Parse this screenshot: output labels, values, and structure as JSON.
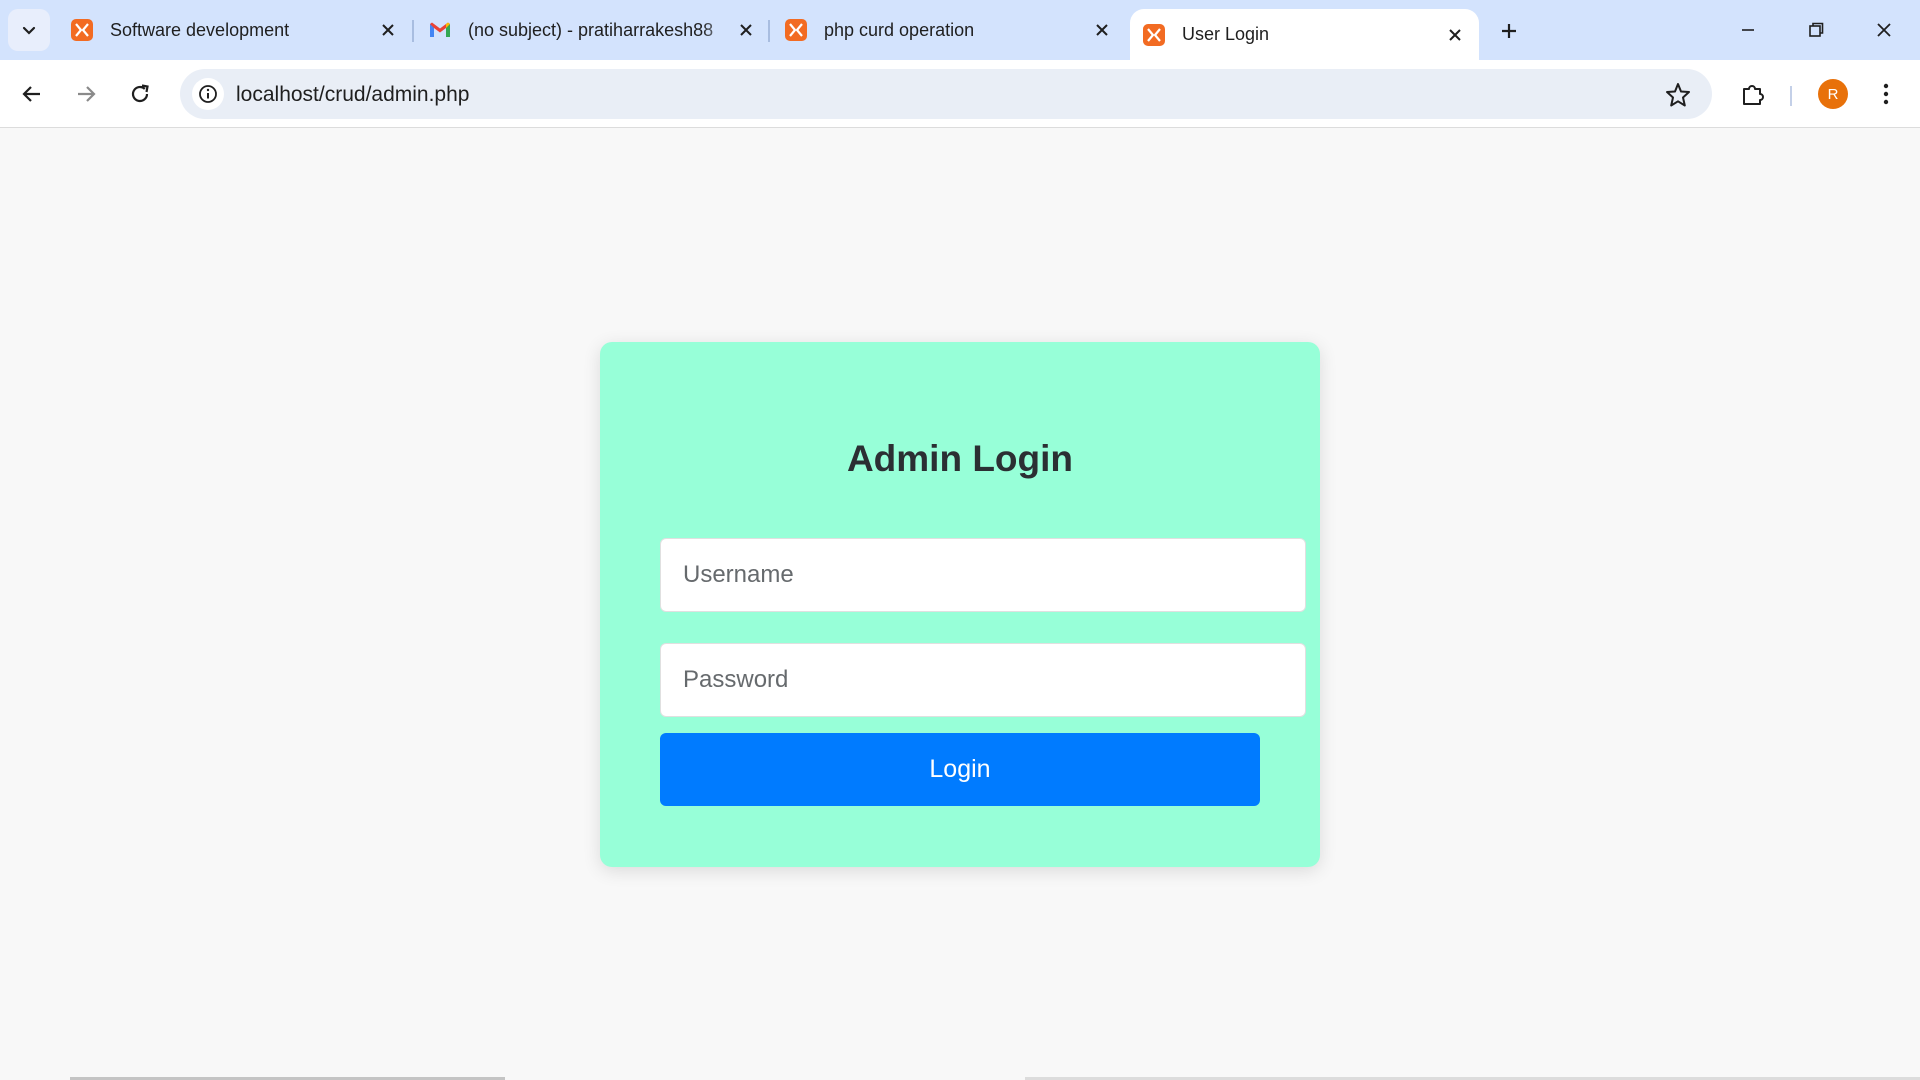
{
  "browser": {
    "tabs": [
      {
        "title": "Software development",
        "icon": "xampp-icon",
        "active": false
      },
      {
        "title": "(no subject) - pratiharrakesh88",
        "icon": "gmail-icon",
        "active": false
      },
      {
        "title": "php curd operation",
        "icon": "xampp-icon",
        "active": false
      },
      {
        "title": "User Login",
        "icon": "xampp-icon",
        "active": true
      }
    ],
    "url": "localhost/crud/admin.php",
    "profile_initial": "R",
    "colors": {
      "tabstrip": "#d3e3fd",
      "accent_favicon": "#f26b22",
      "avatar": "#e8710a"
    }
  },
  "login_form": {
    "heading": "Admin Login",
    "username_placeholder": "Username",
    "password_placeholder": "Password",
    "submit_label": "Login",
    "colors": {
      "card": "#97ffd8",
      "button": "#007bff"
    }
  }
}
